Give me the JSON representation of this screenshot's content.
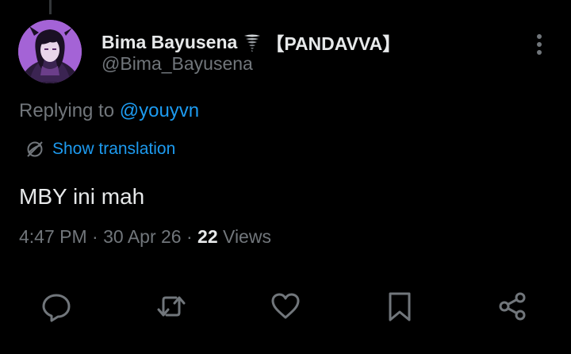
{
  "author": {
    "display_name": "Bima Bayusena",
    "emoji_icon": "tornado-icon",
    "name_suffix": "【PANDAVVA】",
    "handle": "@Bima_Bayusena"
  },
  "reply": {
    "prefix": "Replying to ",
    "mention": "@youyvn"
  },
  "translation": {
    "label": "Show translation",
    "icon": "globe-slash-icon"
  },
  "tweet": {
    "text": "MBY ini mah"
  },
  "meta": {
    "time": "4:47 PM",
    "separator": " · ",
    "date": "30 Apr 26",
    "views_count": "22",
    "views_label": " Views"
  },
  "actions": {
    "icons": [
      "reply-icon",
      "retweet-icon",
      "like-icon",
      "bookmark-icon",
      "share-icon"
    ]
  },
  "colors": {
    "background": "#000000",
    "primary_text": "#e7e9ea",
    "secondary_text": "#71767b",
    "accent": "#1d9bf0",
    "avatar_bg": "#9b59d0"
  }
}
